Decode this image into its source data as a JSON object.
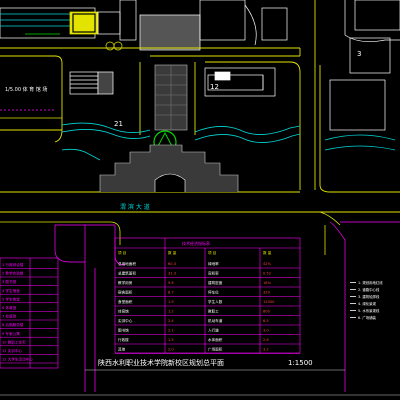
{
  "drawing": {
    "title": "陕西水利职业技术学院新校区规划总平面",
    "scale": "1:1500",
    "road_name": "渭 滨 大 道",
    "building_labels": [
      "21",
      "12",
      "3"
    ],
    "left_labels": [
      "1/5.00 体 育 馆 场"
    ]
  },
  "left_legend": {
    "rows": [
      "1 行政综合楼",
      "2 教学实验楼",
      "3 图书馆",
      "4 学生宿舍",
      "5 学生食堂",
      "6 体育馆",
      "7 校医院",
      "8 后勤服务楼",
      "9 专家公寓",
      "10 教职工住宅",
      "11 实训中心",
      "12 大学生活动中心"
    ]
  },
  "center_table": {
    "header": "技术经济指标表",
    "col_headers": [
      "项 目",
      "数 量",
      "项 目",
      "数 量"
    ],
    "rows": [
      [
        "总用地面积",
        "60.3",
        "绿地率",
        "42%"
      ],
      [
        "总建筑面积",
        "31.3",
        "容积率",
        "0.52"
      ],
      [
        "教学用房",
        "9.6",
        "建筑密度",
        "18%"
      ],
      [
        "宿舍面积",
        "8.7",
        "停车位",
        "320"
      ],
      [
        "食堂面积",
        "1.9",
        "学生人数",
        "12000"
      ],
      [
        "体育馆",
        "1.2",
        "教职工",
        "800"
      ],
      [
        "实训中心",
        "2.4",
        "机动车道",
        "6.5"
      ],
      [
        "图书馆",
        "2.1",
        "人行道",
        "3.0"
      ],
      [
        "行政楼",
        "1.5",
        "水体面积",
        "2.6"
      ],
      [
        "其他",
        "2.0",
        "广场面积",
        "3.2"
      ]
    ]
  },
  "right_legend": {
    "items": [
      "1. 规划用地红线",
      "2. 道路中心线",
      "3. 建筑轮廓线",
      "4. 绿化景观",
      "5. 水系景观线",
      "6. 广场铺装"
    ]
  }
}
